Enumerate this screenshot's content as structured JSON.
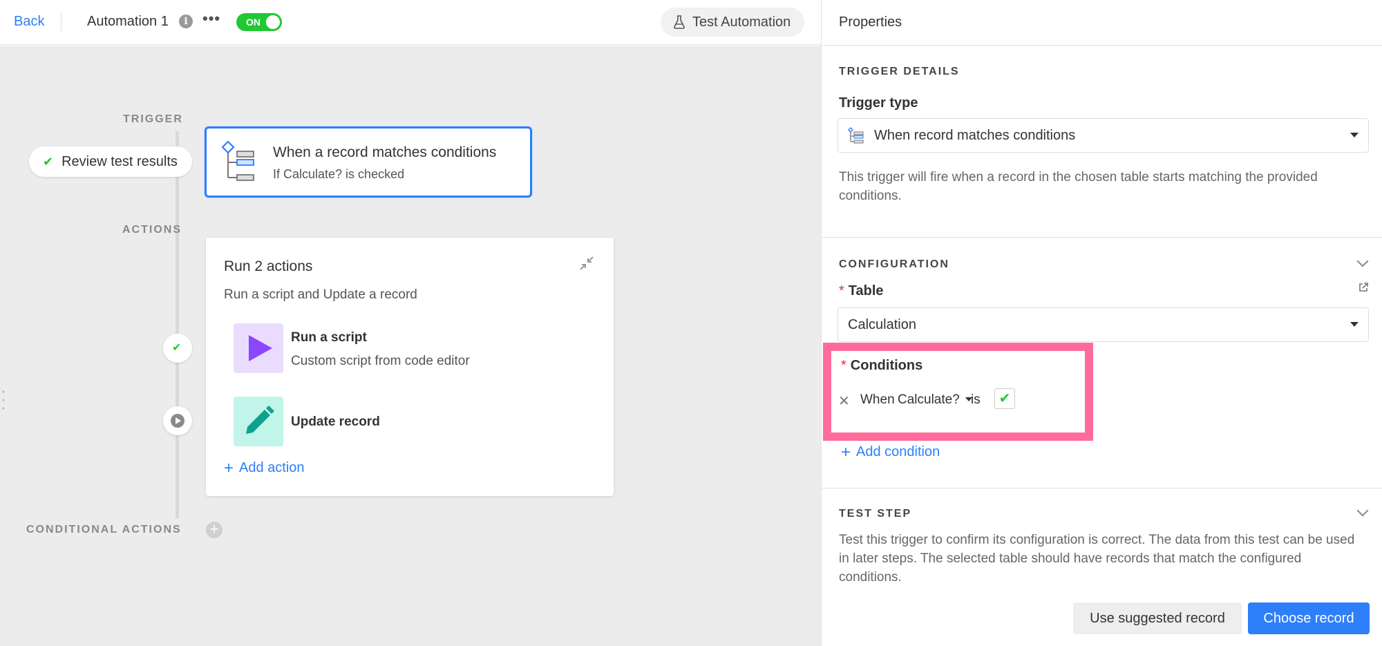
{
  "topbar": {
    "back_label": "Back",
    "automation_name": "Automation 1",
    "info_icon": "info-icon",
    "more_icon": "more-icon",
    "toggle_label": "ON",
    "test_label": "Test Automation"
  },
  "canvas": {
    "trigger_label": "TRIGGER",
    "actions_label": "ACTIONS",
    "conditional_label": "CONDITIONAL ACTIONS",
    "review_label": "Review test results",
    "trigger": {
      "title": "When a record matches conditions",
      "subtitle": "If Calculate? is checked"
    },
    "actions_card": {
      "title": "Run 2 actions",
      "subtitle": "Run a script and Update a record",
      "items": [
        {
          "title": "Run a script",
          "subtitle": "Custom script from code editor",
          "tile_color": "#eadcff",
          "icon_color": "#8b46ff"
        },
        {
          "title": "Update record",
          "subtitle": "",
          "tile_color": "#c2f5e9",
          "icon_color": "#0fa08e"
        }
      ],
      "add_label": "Add action"
    }
  },
  "panel": {
    "title": "Properties",
    "trigger_details": {
      "heading": "TRIGGER DETAILS",
      "type_label": "Trigger type",
      "type_value": "When record matches conditions",
      "description": "This trigger will fire when a record in the chosen table starts matching the provided conditions."
    },
    "configuration": {
      "heading": "CONFIGURATION",
      "table_label": "Table",
      "table_value": "Calculation",
      "conditions_label": "Conditions",
      "condition": {
        "when": "When",
        "field": "Calculate?",
        "operator": "is",
        "value_checked": true
      },
      "add_condition": "Add condition"
    },
    "test_step": {
      "heading": "TEST STEP",
      "description": "Test this trigger to confirm its configuration is correct. The data from this test can be used in later steps. The selected table should have records that match the configured conditions.",
      "suggested_label": "Use suggested record",
      "choose_label": "Choose record"
    }
  },
  "colors": {
    "accent": "#2d7ff9",
    "success": "#20c933",
    "highlight": "#ff6b9a",
    "required": "#e02c3f"
  }
}
